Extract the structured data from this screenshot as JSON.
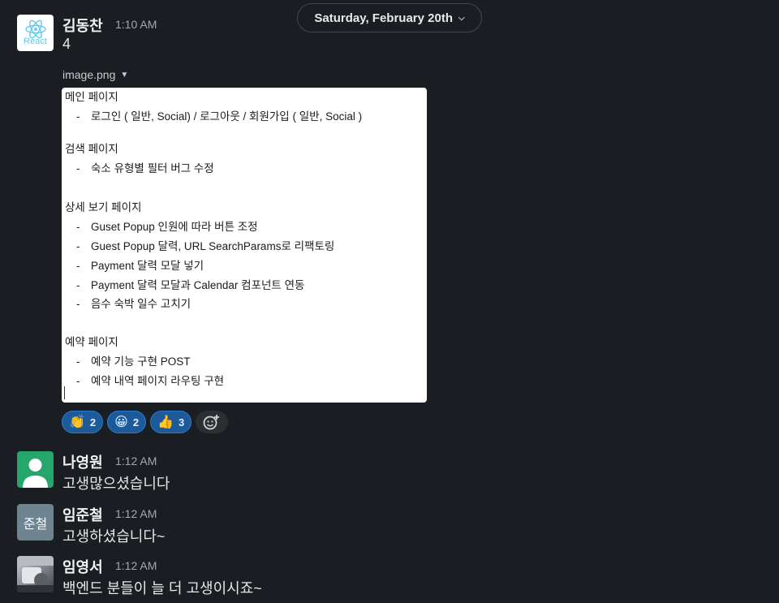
{
  "date_divider": {
    "label": "Saturday, February 20th"
  },
  "messages": [
    {
      "author": "김동찬",
      "time": "1:10 AM",
      "text": "4",
      "avatar": {
        "kind": "react-logo",
        "label": "React"
      },
      "attachment": {
        "filename": "image.png",
        "lines": [
          {
            "type": "heading",
            "text": "메인 페이지"
          },
          {
            "type": "bullet",
            "text": "로그인 ( 일반, Social)  / 로그아웃 / 회원가입 ( 일반, Social )"
          },
          {
            "type": "heading",
            "text": "검색 페이지"
          },
          {
            "type": "bullet",
            "text": "숙소 유형별 필터 버그 수정"
          },
          {
            "type": "heading",
            "text": "상세 보기 페이지"
          },
          {
            "type": "bullet",
            "text": "Guset Popup 인원에 따라 버튼 조정"
          },
          {
            "type": "bullet",
            "text": "Guest Popup 달력, URL SearchParams로 리팩토링"
          },
          {
            "type": "bullet",
            "text": "Payment 달력 모달 넣기"
          },
          {
            "type": "bullet",
            "text": "Payment 달력 모달과 Calendar 컴포넌트 연동"
          },
          {
            "type": "bullet",
            "text": "음수 숙박 일수 고치기"
          },
          {
            "type": "heading",
            "text": "예약 페이지"
          },
          {
            "type": "bullet",
            "text": "예약 기능 구현 POST"
          },
          {
            "type": "bullet",
            "text": "예약 내역 페이지 라우팅 구현"
          }
        ]
      },
      "reactions": [
        {
          "emoji": "👏",
          "count": "2"
        },
        {
          "emoji": "😀",
          "count": "2"
        },
        {
          "emoji": "👍",
          "count": "3"
        }
      ]
    },
    {
      "author": "나영원",
      "time": "1:12 AM",
      "text": "고생많으셨습니다",
      "avatar": {
        "kind": "default-user",
        "color": "#26a66b"
      }
    },
    {
      "author": "임준철",
      "time": "1:12 AM",
      "text": "고생하셨습니다~",
      "avatar": {
        "kind": "initials",
        "label": "준철",
        "color": "#6e8491"
      }
    },
    {
      "author": "임영서",
      "time": "1:12 AM",
      "text": "백엔드 분들이 늘 더 고생이시죠~",
      "avatar": {
        "kind": "photo"
      }
    }
  ],
  "colors": {
    "background": "#1a1d21",
    "reaction_fill": "#1d5a99",
    "reaction_border": "#2b7bd1"
  }
}
